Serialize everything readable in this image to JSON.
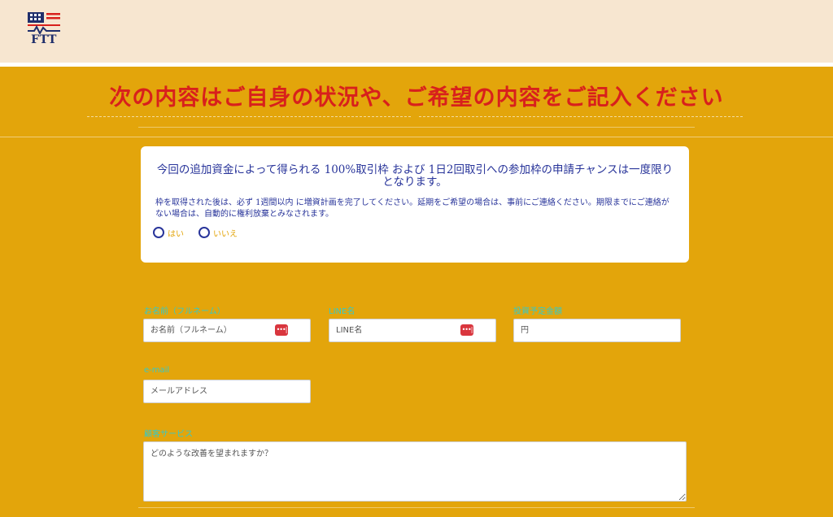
{
  "header": {
    "logo_text": "FTT"
  },
  "headline": "次の内容はご自身の状況や、ご希望の内容をご記入ください",
  "notice": {
    "title": "今回の追加資金によって得られる 100%取引枠 および 1日2回取引への参加枠の申請チャンスは一度限りとなります。",
    "body": "枠を取得された後は、必ず 1週間以内 に増資計画を完了してください。延期をご希望の場合は、事前にご連絡ください。期限までにご連絡がない場合は、自動的に権利放棄とみなされます。",
    "options": [
      "はい",
      "いいえ"
    ]
  },
  "form": {
    "name": {
      "label": "お名前（フルネーム）",
      "placeholder": "お名前（フルネーム）"
    },
    "line": {
      "label": "LINE名",
      "placeholder": "LINE名"
    },
    "amount": {
      "label": "投資予定金額",
      "placeholder": "円"
    },
    "email": {
      "label": "e-mail",
      "placeholder": "メールアドレス"
    },
    "service": {
      "label": "顧客サービス",
      "placeholder": "どのような改善を望まれますか？"
    },
    "pw_icon": "•••|"
  },
  "colors": {
    "background": "#e3a50b",
    "header": "#f7e6d0",
    "headline": "#d8201c",
    "notice_text": "#28349a",
    "label": "#35c9c9"
  }
}
